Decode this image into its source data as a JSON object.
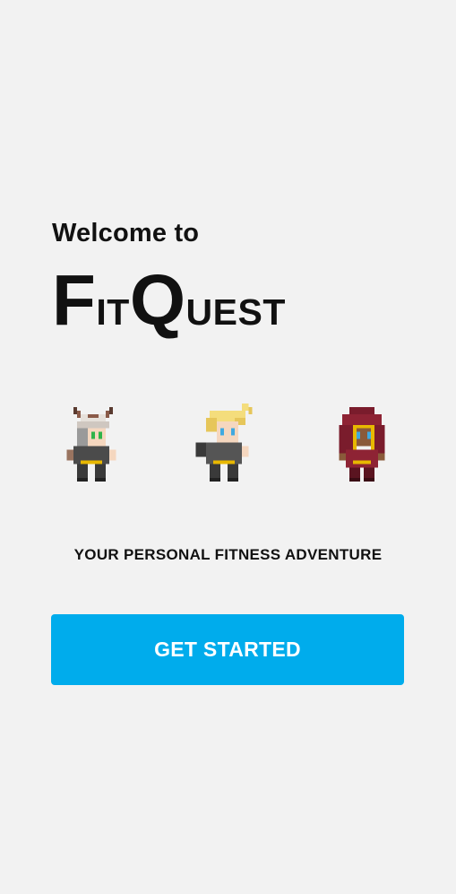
{
  "welcome": {
    "greeting": "Welcome to",
    "title_parts": [
      {
        "text": "F",
        "cap": true
      },
      {
        "text": "it",
        "cap": false
      },
      {
        "text": "Q",
        "cap": true
      },
      {
        "text": "uest",
        "cap": false
      }
    ]
  },
  "characters": [
    {
      "name": "warrior",
      "icon": "horned-warrior-sprite-icon"
    },
    {
      "name": "blonde-hero",
      "icon": "blonde-hero-sprite-icon"
    },
    {
      "name": "hooded-mage",
      "icon": "hooded-mage-sprite-icon"
    }
  ],
  "tagline": "YOUR PERSONAL FITNESS ADVENTURE",
  "cta": {
    "label": "GET STARTED"
  },
  "colors": {
    "background": "#f2f2f2",
    "accent": "#00acec",
    "text": "#111111"
  }
}
